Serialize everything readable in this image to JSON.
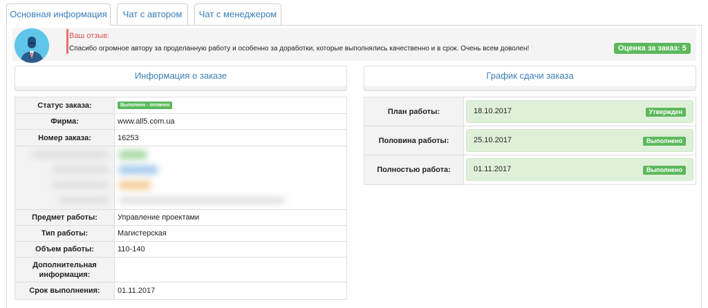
{
  "tabs": [
    {
      "label": "Основная информация",
      "active": true
    },
    {
      "label": "Чат с автором",
      "active": false
    },
    {
      "label": "Чат с менеджером",
      "active": false
    }
  ],
  "review": {
    "label": "Ваш отзыв:",
    "text": "Спасибо огромное автору за проделанную работу и особенно за доработки, которые выполнялись качественно и в срок. Очень всем доволен!",
    "rating": "Оценка за заказ: 5",
    "avatar_icon": "user-avatar-icon"
  },
  "order_info": {
    "title": "Информация о заказе",
    "rows": [
      {
        "key": "Статус заказа:",
        "value": "Выполнен - оплачен",
        "badge": true
      },
      {
        "key": "Фирма:",
        "value": "www.all5.com.ua"
      },
      {
        "key": "Номер заказа:",
        "value": "16253"
      },
      {
        "key": "Предмет работы:",
        "value": "Управление проектами"
      },
      {
        "key": "Тип работы:",
        "value": "Магистерская"
      },
      {
        "key": "Объем работы:",
        "value": "110-140"
      },
      {
        "key": "Дополнительная информация:",
        "value": ""
      },
      {
        "key": "Срок выполнения:",
        "value": "01.11.2017"
      }
    ]
  },
  "schedule": {
    "title": "График сдачи заказа",
    "rows": [
      {
        "key": "План работы:",
        "date": "18.10.2017",
        "status": "Утвержден"
      },
      {
        "key": "Половина работы:",
        "date": "25.10.2017",
        "status": "Выполнено"
      },
      {
        "key": "Полностью работа:",
        "date": "01.11.2017",
        "status": "Выполнено"
      }
    ]
  },
  "colors": {
    "accent": "#3a7eb8",
    "success": "#5cb85c",
    "success_bg": "#dff0d8",
    "review_accent": "#d9534f"
  }
}
